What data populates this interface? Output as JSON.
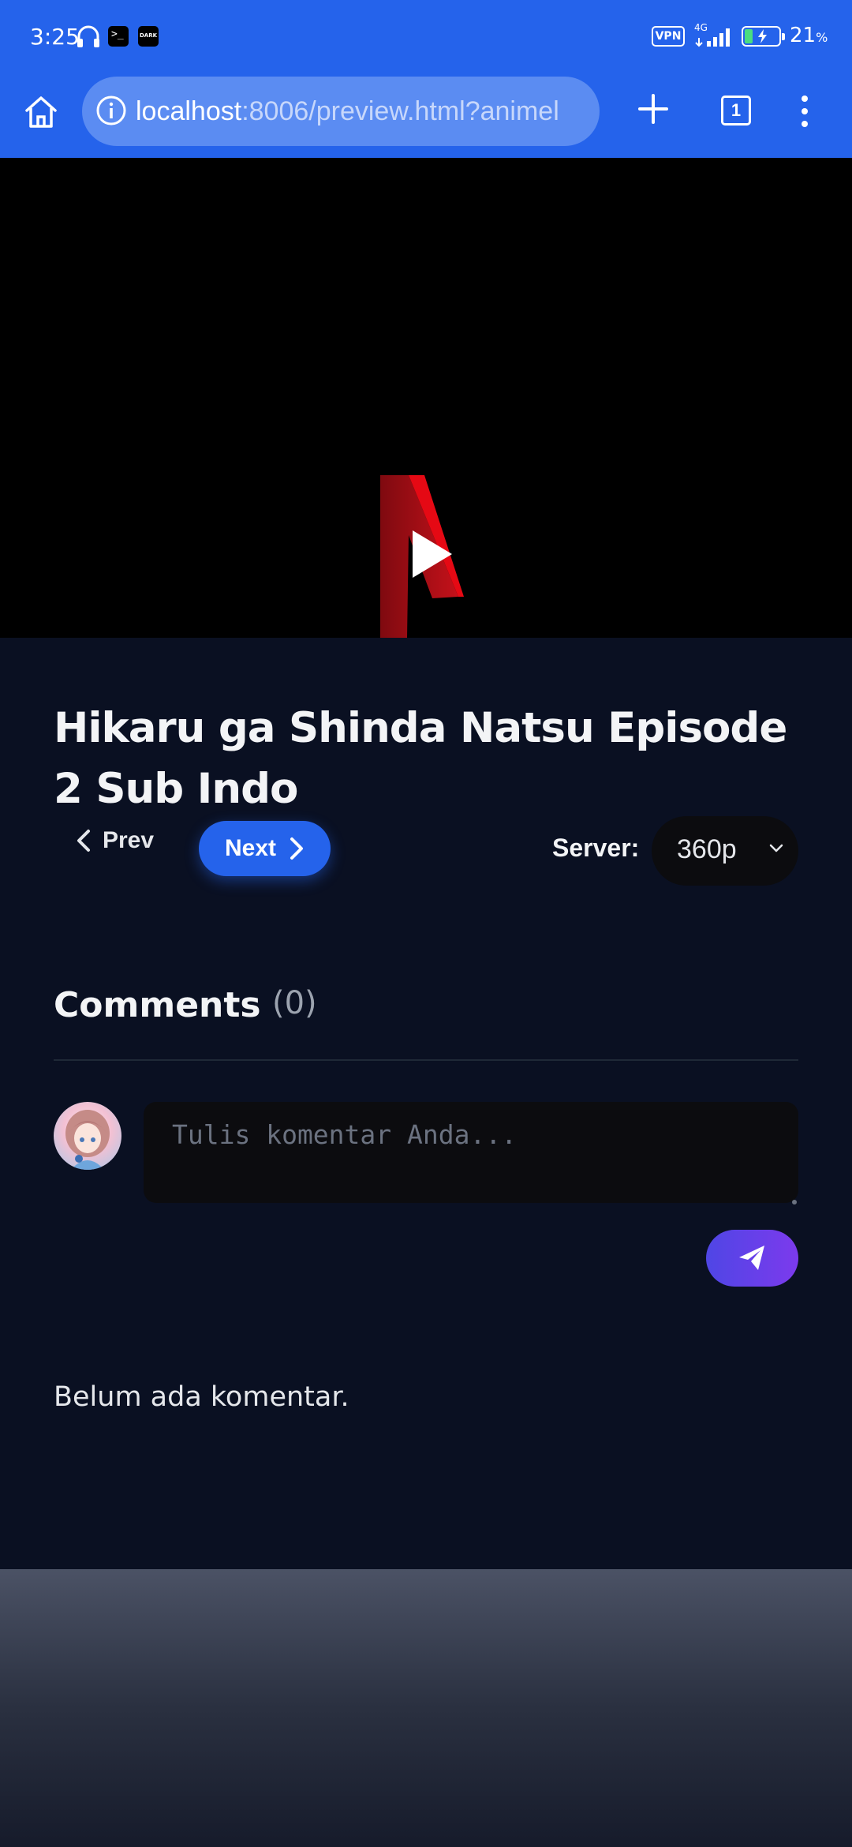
{
  "status_bar": {
    "time": "3:25",
    "network": "4G",
    "vpn_label": "VPN",
    "battery_percent": "21",
    "battery_unit": "%",
    "battery_level": 0.21
  },
  "browser": {
    "url_host": "localhost",
    "url_rest": ":8006/preview.html?animel",
    "tab_count": "1"
  },
  "video": {
    "state": "paused"
  },
  "episode": {
    "title": "Hikaru ga Shinda Natsu Episode 2 Sub Indo",
    "prev_label": "Prev",
    "next_label": "Next",
    "server_label": "Server:",
    "server_value": "360p"
  },
  "comments": {
    "title": "Comments",
    "count": "(0)",
    "input_placeholder": "Tulis komentar Anda...",
    "empty_message": "Belum ada komentar."
  },
  "colors": {
    "chrome": "#2563eb",
    "page_bg": "#0a1022",
    "accent": "#2563eb",
    "send_gradient_start": "#4f46e5",
    "send_gradient_end": "#7c3aed"
  }
}
